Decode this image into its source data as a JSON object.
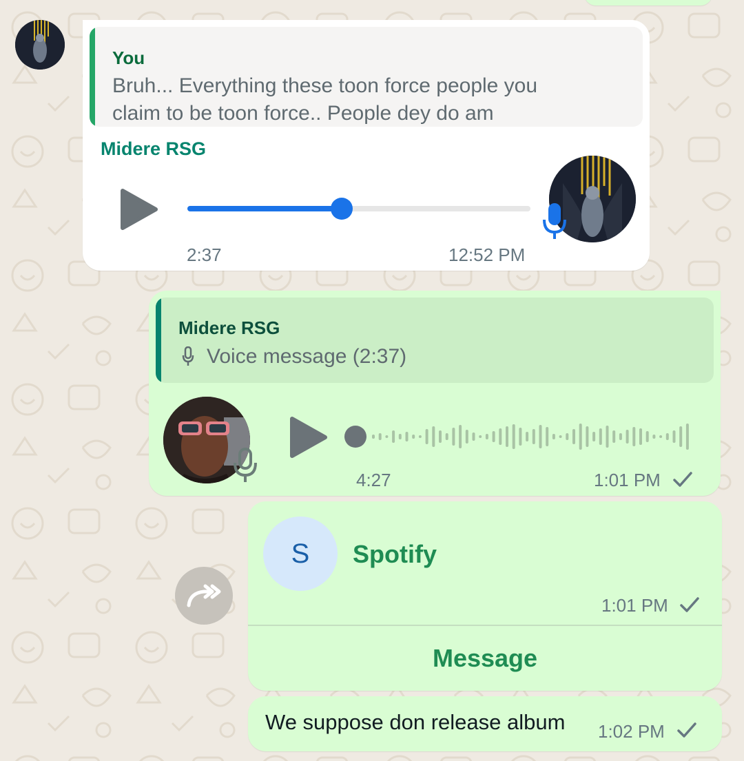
{
  "colors": {
    "chat_bg": "#efeae2",
    "incoming_bubble": "#ffffff",
    "outgoing_bubble": "#d9fdd3",
    "accent_green": "#1f8c53",
    "accent_teal": "#06846e",
    "progress_blue": "#1a73e8",
    "meta_text": "#667781"
  },
  "messages": {
    "incoming_voice": {
      "quote": {
        "author": "You",
        "text_line1": "Bruh... Everything these toon force people you",
        "text_line2": "claim to be toon force.. People dey do am"
      },
      "sender": "Midere RSG",
      "play_icon": "play-icon",
      "mic_icon": "microphone-icon",
      "progress": 0.45,
      "duration": "2:37",
      "time": "12:52 PM"
    },
    "outgoing_voice": {
      "quote": {
        "author": "Midere RSG",
        "mic_icon": "small-mic-icon",
        "text": "Voice message (2:37)"
      },
      "play_icon": "play-icon",
      "mic_icon": "microphone-icon",
      "duration": "4:27",
      "time": "1:01 PM",
      "status_icon": "single-check-icon"
    },
    "contact_card": {
      "initial": "S",
      "name": "Spotify",
      "time": "1:01 PM",
      "status_icon": "single-check-icon",
      "action_label": "Message",
      "forward_icon": "forward-arrow-icon"
    },
    "text_message": {
      "text": "We suppose don release album",
      "time": "1:02 PM",
      "status_icon": "single-check-icon"
    }
  }
}
